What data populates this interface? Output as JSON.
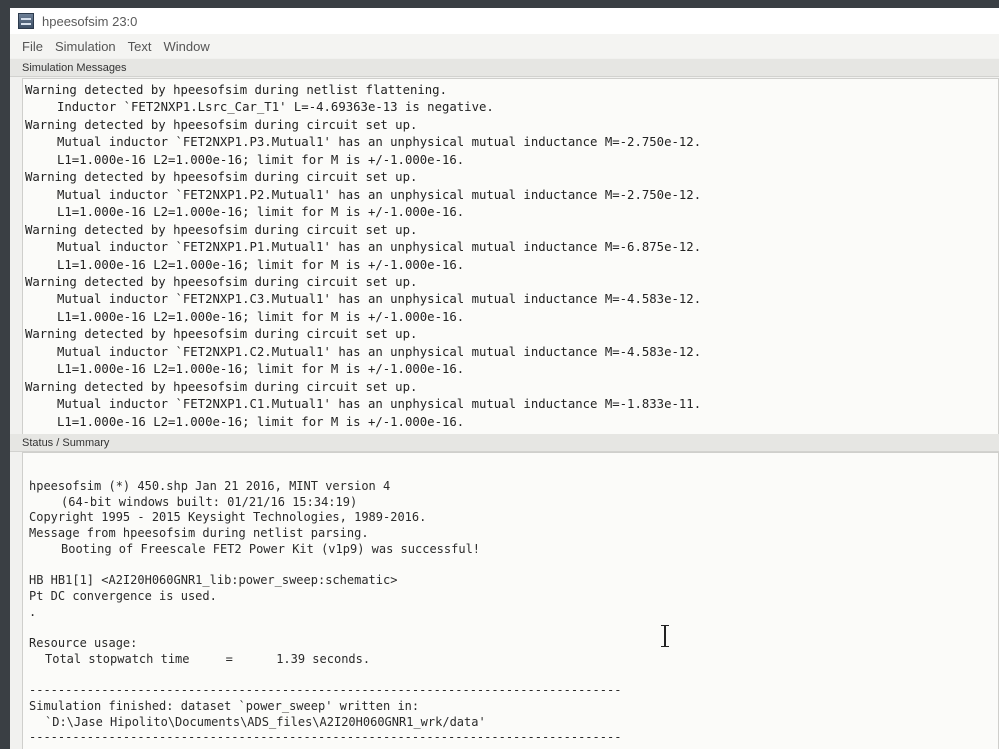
{
  "window": {
    "title": "hpeesofsim 23:0"
  },
  "menu": [
    "File",
    "Simulation",
    "Text",
    "Window"
  ],
  "sections": {
    "messages": "Simulation Messages",
    "status": "Status / Summary"
  },
  "messages": [
    {
      "text": "Warning detected by hpeesofsim during netlist flattening.",
      "indent": 0
    },
    {
      "text": "Inductor `FET2NXP1.Lsrc_Car_T1' L=-4.69363e-13 is negative.",
      "indent": 1
    },
    {
      "text": "Warning detected by hpeesofsim during circuit set up.",
      "indent": 0
    },
    {
      "text": "Mutual inductor `FET2NXP1.P3.Mutual1' has an unphysical mutual inductance M=-2.750e-12.",
      "indent": 1
    },
    {
      "text": "L1=1.000e-16 L2=1.000e-16; limit for M is +/-1.000e-16.",
      "indent": 1
    },
    {
      "text": "Warning detected by hpeesofsim during circuit set up.",
      "indent": 0
    },
    {
      "text": "Mutual inductor `FET2NXP1.P2.Mutual1' has an unphysical mutual inductance M=-2.750e-12.",
      "indent": 1
    },
    {
      "text": "L1=1.000e-16 L2=1.000e-16; limit for M is +/-1.000e-16.",
      "indent": 1
    },
    {
      "text": "Warning detected by hpeesofsim during circuit set up.",
      "indent": 0
    },
    {
      "text": "Mutual inductor `FET2NXP1.P1.Mutual1' has an unphysical mutual inductance M=-6.875e-12.",
      "indent": 1
    },
    {
      "text": "L1=1.000e-16 L2=1.000e-16; limit for M is +/-1.000e-16.",
      "indent": 1
    },
    {
      "text": "Warning detected by hpeesofsim during circuit set up.",
      "indent": 0
    },
    {
      "text": "Mutual inductor `FET2NXP1.C3.Mutual1' has an unphysical mutual inductance M=-4.583e-12.",
      "indent": 1
    },
    {
      "text": "L1=1.000e-16 L2=1.000e-16; limit for M is +/-1.000e-16.",
      "indent": 1
    },
    {
      "text": "Warning detected by hpeesofsim during circuit set up.",
      "indent": 0
    },
    {
      "text": "Mutual inductor `FET2NXP1.C2.Mutual1' has an unphysical mutual inductance M=-4.583e-12.",
      "indent": 1
    },
    {
      "text": "L1=1.000e-16 L2=1.000e-16; limit for M is +/-1.000e-16.",
      "indent": 1
    },
    {
      "text": "Warning detected by hpeesofsim during circuit set up.",
      "indent": 0
    },
    {
      "text": "Mutual inductor `FET2NXP1.C1.Mutual1' has an unphysical mutual inductance M=-1.833e-11.",
      "indent": 1
    },
    {
      "text": "L1=1.000e-16 L2=1.000e-16; limit for M is +/-1.000e-16.",
      "indent": 1
    }
  ],
  "status": [
    {
      "text": "hpeesofsim (*) 450.shp Jan 21 2016, MINT version 4",
      "indent": 0
    },
    {
      "text": "(64-bit windows built: 01/21/16 15:34:19)",
      "indent": 1
    },
    {
      "text": "Copyright 1995 - 2015 Keysight Technologies, 1989-2016.",
      "indent": 0
    },
    {
      "text": "Message from hpeesofsim during netlist parsing.",
      "indent": 0
    },
    {
      "text": "Booting of Freescale FET2 Power Kit (v1p9) was successful!",
      "indent": 1
    },
    {
      "text": "",
      "indent": 0
    },
    {
      "text": "HB HB1[1] <A2I20H060GNR1_lib:power_sweep:schematic>",
      "indent": 0
    },
    {
      "text": "Pt DC convergence is used.",
      "indent": 0
    },
    {
      "text": ".",
      "indent": 0
    },
    {
      "text": "",
      "indent": 0
    },
    {
      "text": "Resource usage:",
      "indent": 0
    },
    {
      "text": "Total stopwatch time     =      1.39 seconds.",
      "indent": 2
    },
    {
      "text": "",
      "indent": 0
    },
    {
      "text": "----------------------------------------------------------------------------------",
      "indent": 0
    },
    {
      "text": "Simulation finished: dataset `power_sweep' written in:",
      "indent": 0
    },
    {
      "text": "`D:\\Jase Hipolito\\Documents\\ADS_files\\A2I20H060GNR1_wrk/data'",
      "indent": 2
    },
    {
      "text": "----------------------------------------------------------------------------------",
      "indent": 0
    }
  ]
}
